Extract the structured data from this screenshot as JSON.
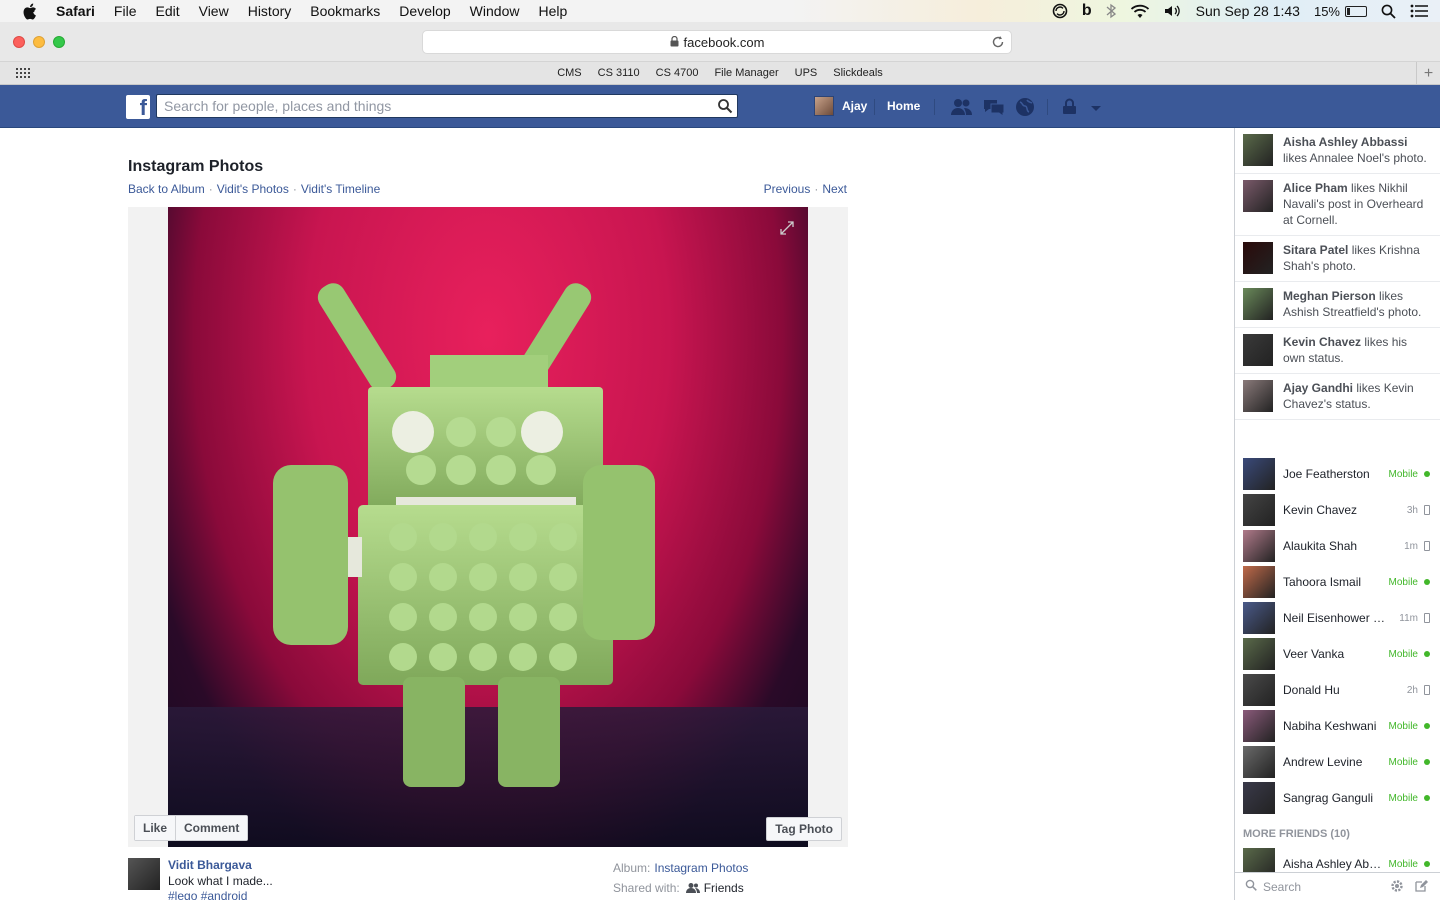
{
  "menubar": {
    "app": "Safari",
    "items": [
      "File",
      "Edit",
      "View",
      "History",
      "Bookmarks",
      "Develop",
      "Window",
      "Help"
    ],
    "clock": "Sun Sep 28  1:43",
    "battery_pct": "15%",
    "battery_level": 0.15
  },
  "browser": {
    "url": "facebook.com",
    "bookmarks": [
      "CMS",
      "CS 3110",
      "CS 4700",
      "File Manager",
      "UPS",
      "Slickdeals"
    ]
  },
  "fb": {
    "logo": "f",
    "search_placeholder": "Search for people, places and things",
    "user": "Ajay",
    "home": "Home"
  },
  "photo_page": {
    "title": "Instagram Photos",
    "crumbs": [
      "Back to Album",
      "Vidit's Photos",
      "Vidit's Timeline"
    ],
    "prev": "Previous",
    "next": "Next",
    "like": "Like",
    "comment": "Comment",
    "tag": "Tag Photo",
    "author": "Vidit Bhargava",
    "caption": "Look what I made...",
    "tags": "#lego #android",
    "album_label": "Album:",
    "album": "Instagram Photos",
    "shared_label": "Shared with:",
    "shared": "Friends"
  },
  "ticker": [
    {
      "name": "Aisha Ashley Abbassi",
      "text": "likes Annalee Noel's photo.",
      "color": "#5a6a4a"
    },
    {
      "name": "Alice Pham",
      "text": "likes Nikhil Navali's post in Overheard at Cornell.",
      "color": "#7a5a6a"
    },
    {
      "name": "Sitara Patel",
      "text": "likes Krishna Shah's photo.",
      "color": "#2a0a0a"
    },
    {
      "name": "Meghan Pierson",
      "text": "likes Ashish Streatfield's photo.",
      "color": "#6a8a5a"
    },
    {
      "name": "Kevin Chavez",
      "text": "likes his own status.",
      "color": "#3a3a3a"
    },
    {
      "name": "Ajay Gandhi",
      "text": "likes Kevin Chavez's status.",
      "color": "#8a7a7a"
    }
  ],
  "chat": [
    {
      "name": "Joe Featherston",
      "status": "Mobile",
      "kind": "mobile",
      "color": "#3a4a7a"
    },
    {
      "name": "Kevin Chavez",
      "status": "3h",
      "kind": "idle",
      "color": "#444444"
    },
    {
      "name": "Alaukita Shah",
      "status": "1m",
      "kind": "idle",
      "color": "#b07a8a"
    },
    {
      "name": "Tahoora Ismail",
      "status": "Mobile",
      "kind": "mobile",
      "color": "#c06a4a"
    },
    {
      "name": "Neil Eisenhower Hui",
      "status": "11m",
      "kind": "idle",
      "color": "#4a5a8a"
    },
    {
      "name": "Veer Vanka",
      "status": "Mobile",
      "kind": "mobile",
      "color": "#5a6a4a"
    },
    {
      "name": "Donald Hu",
      "status": "2h",
      "kind": "idle",
      "color": "#4a4a4a"
    },
    {
      "name": "Nabiha Keshwani",
      "status": "Mobile",
      "kind": "mobile",
      "color": "#8a5a7a"
    },
    {
      "name": "Andrew Levine",
      "status": "Mobile",
      "kind": "mobile",
      "color": "#6a6a6a"
    },
    {
      "name": "Sangrag Ganguli",
      "status": "Mobile",
      "kind": "mobile",
      "color": "#3a3a4a"
    }
  ],
  "more_friends": "MORE FRIENDS (10)",
  "chat_more": {
    "name": "Aisha Ashley Abbassi",
    "status": "Mobile",
    "color": "#5a6a4a"
  },
  "chat_search": "Search"
}
